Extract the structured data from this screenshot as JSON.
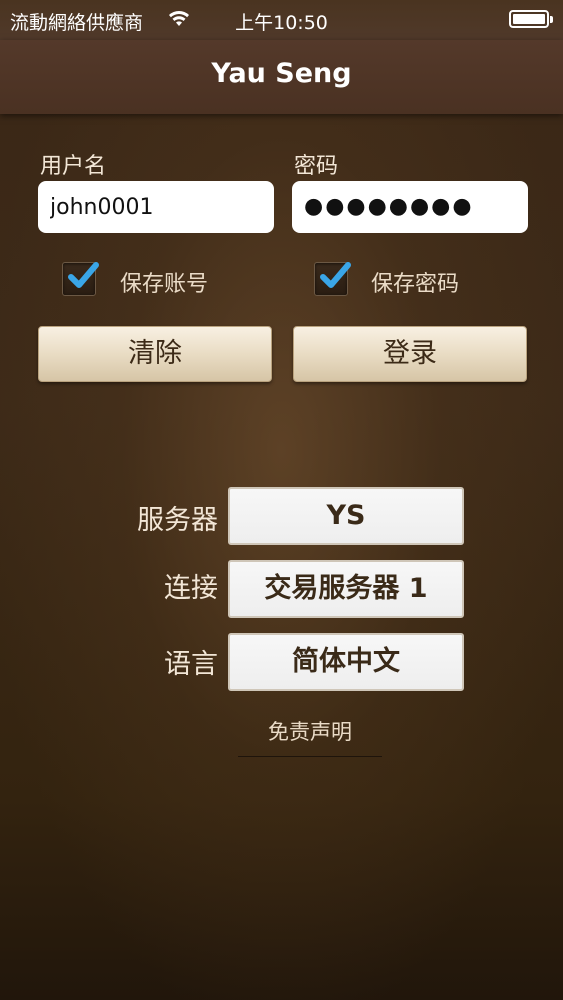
{
  "status_bar": {
    "carrier": "流動網絡供應商",
    "time": "上午10:50",
    "wifi_icon": "wifi-icon",
    "battery_icon": "battery-icon"
  },
  "nav": {
    "title": "Yau Seng"
  },
  "login": {
    "username_label": "用户名",
    "username_value": "john0001",
    "password_label": "密码",
    "password_mask": "●●●●●●●●",
    "save_account_label": "保存账号",
    "save_password_label": "保存密码",
    "clear_label": "清除",
    "login_label": "登录"
  },
  "settings": {
    "server_label": "服务器",
    "server_value": "YS",
    "connection_label": "连接",
    "connection_value": "交易服务器 1",
    "language_label": "语言",
    "language_value": "简体中文"
  },
  "disclaimer": "免责声明",
  "colors": {
    "background": "#3a2716",
    "nav_bar": "#4d3424",
    "check_accent": "#3aa6e8",
    "button_text": "#3c2a17"
  }
}
